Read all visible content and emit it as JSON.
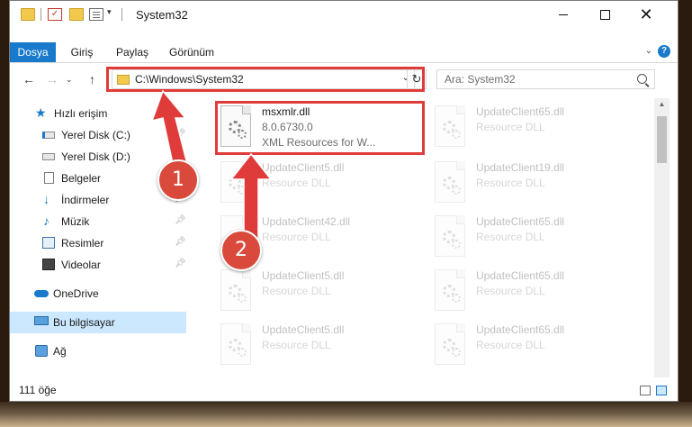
{
  "window": {
    "title": "System32"
  },
  "ribbon": {
    "tabs": [
      "Dosya",
      "Giriş",
      "Paylaş",
      "Görünüm"
    ],
    "help": "?"
  },
  "address": {
    "path": "C:\\Windows\\System32",
    "search_placeholder": "Ara: System32"
  },
  "nav": {
    "items": [
      {
        "label": "Hızlı erişim",
        "icon": "star-icon",
        "pinned": false
      },
      {
        "label": "Yerel Disk (C:)",
        "icon": "drive-icon",
        "pinned": true
      },
      {
        "label": "Yerel Disk (D:)",
        "icon": "drive-icon",
        "pinned": true
      },
      {
        "label": "Belgeler",
        "icon": "documents-icon",
        "pinned": true
      },
      {
        "label": "İndirmeler",
        "icon": "download-icon",
        "pinned": true
      },
      {
        "label": "Müzik",
        "icon": "music-icon",
        "pinned": true
      },
      {
        "label": "Resimler",
        "icon": "pictures-icon",
        "pinned": true
      },
      {
        "label": "Videolar",
        "icon": "video-icon",
        "pinned": true
      },
      {
        "label": "OneDrive",
        "icon": "cloud-icon",
        "pinned": false
      },
      {
        "label": "Bu bilgisayar",
        "icon": "computer-icon",
        "pinned": false,
        "selected": true
      },
      {
        "label": "Ağ",
        "icon": "network-icon",
        "pinned": false
      }
    ]
  },
  "files": [
    {
      "name": "msxmlr.dll",
      "version": "8.0.6730.0",
      "description": "XML Resources for W...",
      "highlighted": true
    },
    {
      "name": "UpdateClient65.dll",
      "description": "Resource DLL"
    },
    {
      "name": "UpdateClient5.dll",
      "description": "Resource DLL"
    },
    {
      "name": "UpdateClient19.dll",
      "description": "Resource DLL"
    },
    {
      "name": "UpdateClient42.dll",
      "description": "Resource DLL"
    },
    {
      "name": "UpdateClient65.dll",
      "description": "Resource DLL"
    },
    {
      "name": "UpdateClient5.dll",
      "description": "Resource DLL"
    },
    {
      "name": "UpdateClient65.dll",
      "description": "Resource DLL"
    },
    {
      "name": "UpdateClient5.dll",
      "description": "Resource DLL"
    },
    {
      "name": "UpdateClient65.dll",
      "description": "Resource DLL"
    }
  ],
  "status": {
    "item_count": "111 öğe"
  },
  "annotations": {
    "step1": "1",
    "step2": "2",
    "color": "#e03b3b"
  }
}
